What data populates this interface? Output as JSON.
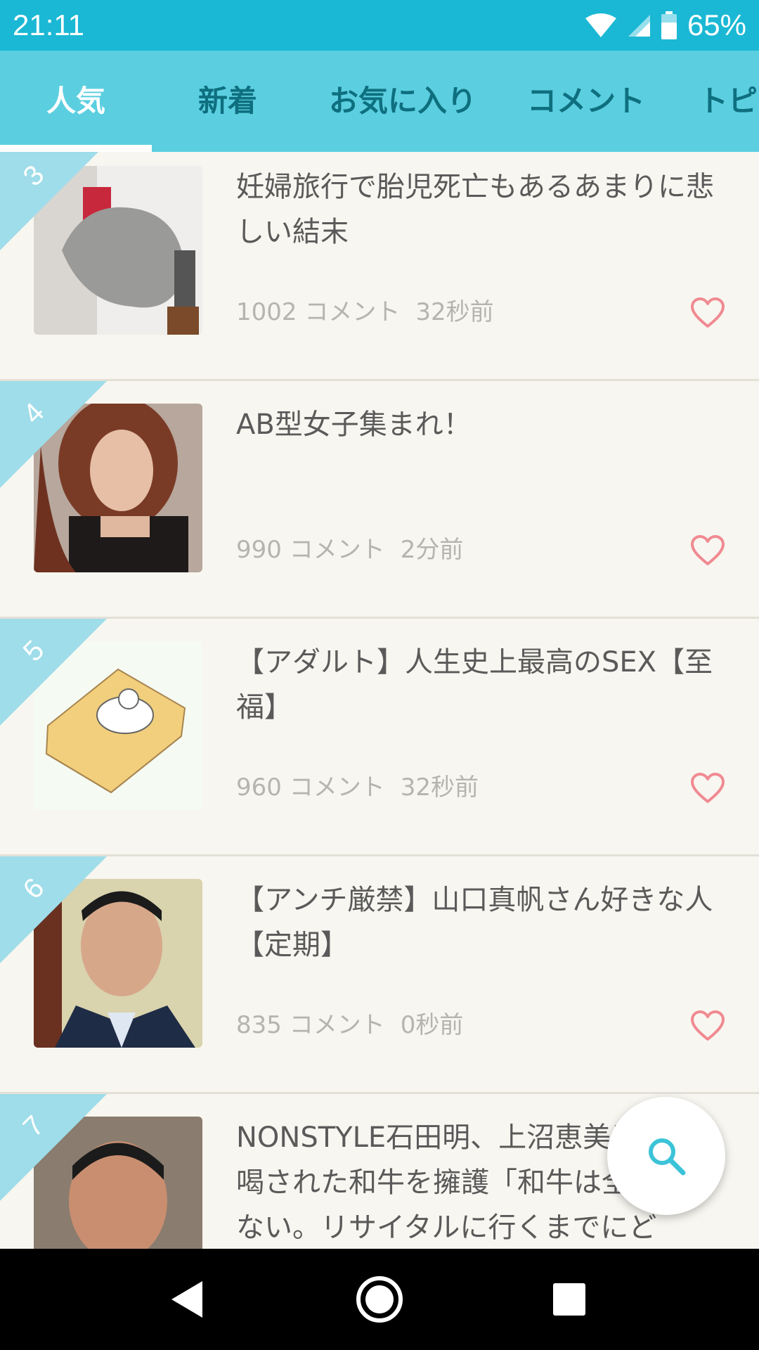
{
  "status": {
    "time": "21:11",
    "battery": "65%"
  },
  "tabs": [
    {
      "label": "人気",
      "active": true
    },
    {
      "label": "新着"
    },
    {
      "label": "お気に入り"
    },
    {
      "label": "コメント"
    },
    {
      "label": "トピ"
    }
  ],
  "items": [
    {
      "rank": "3",
      "title": "妊婦旅行で胎児死亡もあるあまりに悲しい結末",
      "comments": "1002 コメント",
      "time": "32秒前"
    },
    {
      "rank": "4",
      "title": "AB型女子集まれ！",
      "comments": "990 コメント",
      "time": "2分前"
    },
    {
      "rank": "5",
      "title": "【アダルト】人生史上最高のSEX【至福】",
      "comments": "960 コメント",
      "time": "32秒前"
    },
    {
      "rank": "6",
      "title": "【アンチ厳禁】山口真帆さん好きな人【定期】",
      "comments": "835 コメント",
      "time": "0秒前"
    },
    {
      "rank": "7",
      "title": "NONSTYLE石田明、上沼恵美子に一喝された和牛を擁護「和牛は全然悪くない。リサイタルに行くまでにど"
    }
  ],
  "colors": {
    "accent": "#1ab8d4",
    "tab_bg": "#5bcfe0",
    "ribbon": "#9edde9",
    "heart": "#f08a92"
  },
  "icons": {
    "fab": "search-icon",
    "heart": "heart-outline-icon"
  }
}
